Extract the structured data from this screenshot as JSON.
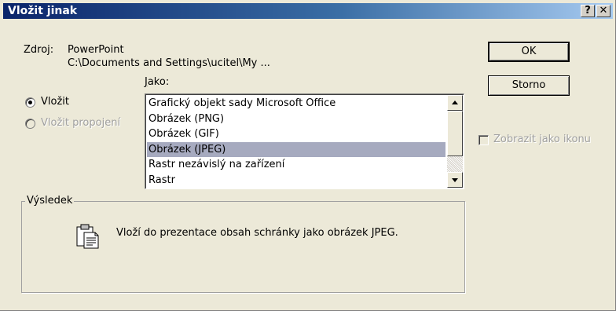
{
  "window": {
    "title": "Vložit jinak",
    "help_label": "?",
    "close_label": "✕"
  },
  "source": {
    "label": "Zdroj:",
    "app": "PowerPoint",
    "path": "C:\\Documents and Settings\\ucitel\\My ..."
  },
  "as_label": "Jako:",
  "options": {
    "paste_label": "Vložit",
    "paste_link_label": "Vložit propojení",
    "selected": "paste"
  },
  "formats": {
    "items": [
      "Grafický objekt sady Microsoft Office",
      "Obrázek (PNG)",
      "Obrázek (GIF)",
      "Obrázek (JPEG)",
      "Rastr nezávislý na zařízení",
      "Rastr"
    ],
    "selected_index": 3
  },
  "buttons": {
    "ok_label": "OK",
    "cancel_label": "Storno"
  },
  "display_as_icon": {
    "label": "Zobrazit jako ikonu",
    "checked": false,
    "enabled": false
  },
  "result": {
    "legend": "Výsledek",
    "text": "Vloží do prezentace obsah schránky jako obrázek JPEG.",
    "icon": "paste-clipboard-icon"
  },
  "colors": {
    "title_bar_start": "#0a246a",
    "title_bar_end": "#a6caf0",
    "dialog_bg": "#ece9d8",
    "selection_bg": "#a6aabf"
  }
}
